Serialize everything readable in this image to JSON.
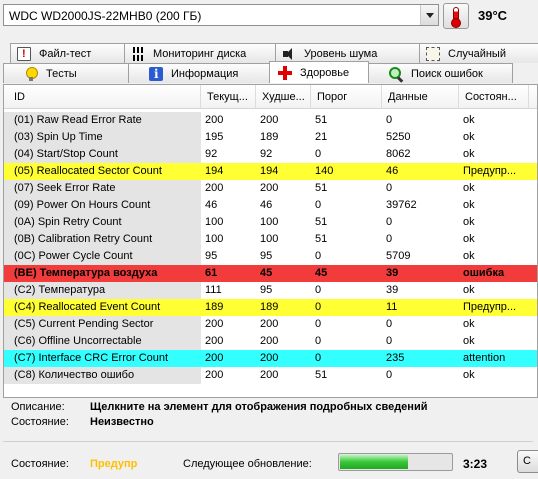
{
  "drive": {
    "name": "WDC WD2000JS-22MHB0 (200 ГБ)",
    "temperature": "39°C"
  },
  "tabs_row1": [
    {
      "label": "Файл-тест",
      "icon": "test-file-icon"
    },
    {
      "label": "Мониторинг диска",
      "icon": "monitor-chart-icon"
    },
    {
      "label": "Уровень шума",
      "icon": "speaker-icon"
    },
    {
      "label": "Случайный",
      "icon": "random-icon"
    }
  ],
  "tabs_row2": [
    {
      "label": "Тесты",
      "icon": "lightbulb-icon"
    },
    {
      "label": "Информация",
      "icon": "info-icon"
    },
    {
      "label": "Здоровье",
      "icon": "health-cross-icon",
      "active": true
    },
    {
      "label": "Поиск ошибок",
      "icon": "magnifier-icon"
    }
  ],
  "table": {
    "headers": [
      "ID",
      "Текущ...",
      "Худше...",
      "Порог",
      "Данные",
      "Состоян..."
    ],
    "rows": [
      {
        "id": "(01) Raw Read Error Rate",
        "cur": "200",
        "worst": "200",
        "thr": "51",
        "raw": "0",
        "status": "ok",
        "hl": ""
      },
      {
        "id": "(03) Spin Up Time",
        "cur": "195",
        "worst": "189",
        "thr": "21",
        "raw": "5250",
        "status": "ok",
        "hl": ""
      },
      {
        "id": "(04) Start/Stop Count",
        "cur": "92",
        "worst": "92",
        "thr": "0",
        "raw": "8062",
        "status": "ok",
        "hl": ""
      },
      {
        "id": "(05) Reallocated Sector Count",
        "cur": "194",
        "worst": "194",
        "thr": "140",
        "raw": "46",
        "status": "Предупр...",
        "hl": "yellow"
      },
      {
        "id": "(07) Seek Error Rate",
        "cur": "200",
        "worst": "200",
        "thr": "51",
        "raw": "0",
        "status": "ok",
        "hl": ""
      },
      {
        "id": "(09) Power On Hours Count",
        "cur": "46",
        "worst": "46",
        "thr": "0",
        "raw": "39762",
        "status": "ok",
        "hl": ""
      },
      {
        "id": "(0A) Spin Retry Count",
        "cur": "100",
        "worst": "100",
        "thr": "51",
        "raw": "0",
        "status": "ok",
        "hl": ""
      },
      {
        "id": "(0B) Calibration Retry Count",
        "cur": "100",
        "worst": "100",
        "thr": "51",
        "raw": "0",
        "status": "ok",
        "hl": ""
      },
      {
        "id": "(0C) Power Cycle Count",
        "cur": "95",
        "worst": "95",
        "thr": "0",
        "raw": "5709",
        "status": "ok",
        "hl": ""
      },
      {
        "id": "(BE) Температура воздуха",
        "cur": "61",
        "worst": "45",
        "thr": "45",
        "raw": "39",
        "status": "ошибка",
        "hl": "red"
      },
      {
        "id": "(C2) Температура",
        "cur": "111",
        "worst": "95",
        "thr": "0",
        "raw": "39",
        "status": "ok",
        "hl": ""
      },
      {
        "id": "(C4) Reallocated Event Count",
        "cur": "189",
        "worst": "189",
        "thr": "0",
        "raw": "11",
        "status": "Предупр...",
        "hl": "yellow"
      },
      {
        "id": "(C5) Current Pending Sector",
        "cur": "200",
        "worst": "200",
        "thr": "0",
        "raw": "0",
        "status": "ok",
        "hl": ""
      },
      {
        "id": "(C6) Offline Uncorrectable",
        "cur": "200",
        "worst": "200",
        "thr": "0",
        "raw": "0",
        "status": "ok",
        "hl": ""
      },
      {
        "id": "(C7) Interface CRC Error Count",
        "cur": "200",
        "worst": "200",
        "thr": "0",
        "raw": "235",
        "status": "attention",
        "hl": "cyan"
      },
      {
        "id": "(C8) Количество ошибо",
        "cur": "200",
        "worst": "200",
        "thr": "51",
        "raw": "0",
        "status": "ok",
        "hl": ""
      }
    ]
  },
  "details": {
    "desc_label": "Описание:",
    "desc_value": "Щелкните на элемент для отображения подробных сведений",
    "state_label": "Состояние:",
    "state_value": "Неизвестно"
  },
  "footer": {
    "status_label": "Состояние:",
    "status_value": "Предупр",
    "next_update_label": "Следующее обновление:",
    "progress_fraction": 0.6,
    "countdown": "3:23",
    "corner_button": "C"
  },
  "colors": {
    "warning": "#ffff33",
    "error": "#f23b3b",
    "attention": "#33ffff",
    "status_warning_text": "#ffbf00"
  }
}
